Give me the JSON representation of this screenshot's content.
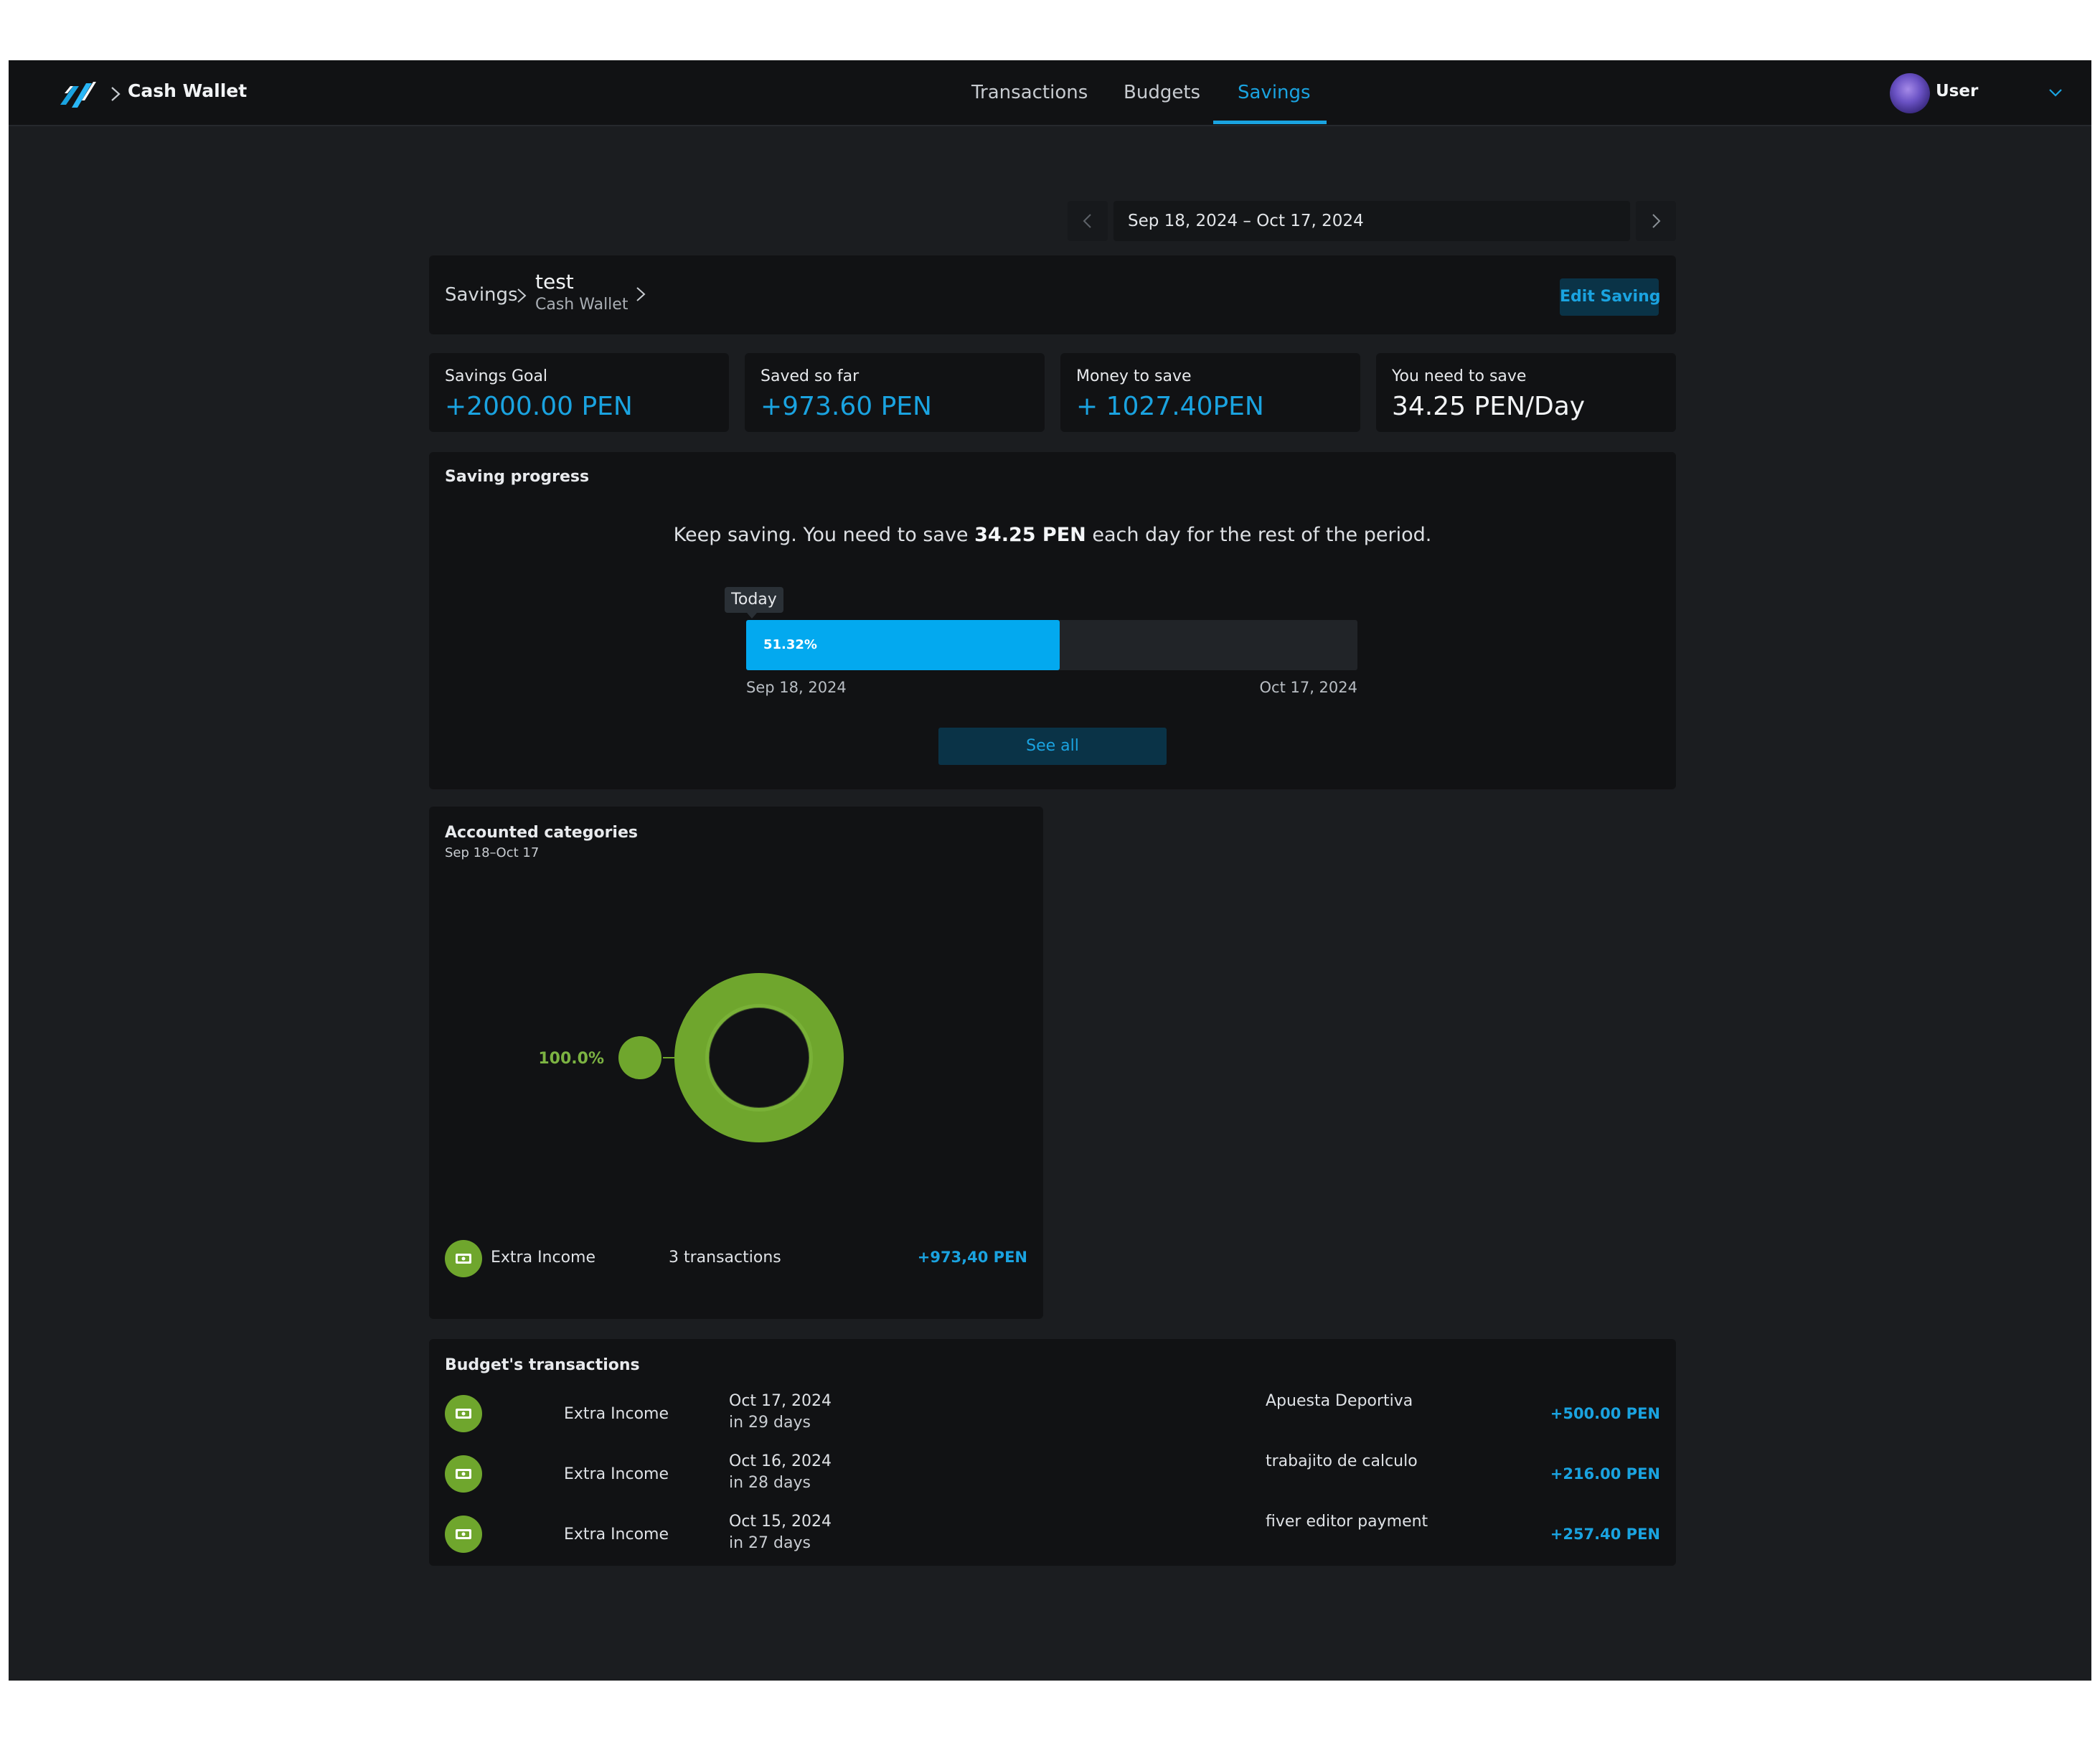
{
  "topbar": {
    "wallet_name": "Cash Wallet",
    "tabs": [
      {
        "label": "Transactions",
        "active": false
      },
      {
        "label": "Budgets",
        "active": false
      },
      {
        "label": "Savings",
        "active": true
      }
    ],
    "user_name": "User",
    "accent_color": "#1aa3e0"
  },
  "period": {
    "range": "Sep 18, 2024 – Oct 17, 2024"
  },
  "breadcrumb": {
    "root": "Savings",
    "saving_name": "test",
    "wallet": "Cash Wallet",
    "edit_label": "Edit Saving"
  },
  "stats": [
    {
      "label": "Savings Goal",
      "value": "+2000.00 PEN"
    },
    {
      "label": "Saved so far",
      "value": "+973.60 PEN"
    },
    {
      "label": "Money to save",
      "value": "+ 1027.40PEN"
    },
    {
      "label": "You need to save",
      "value": "34.25 PEN/Day"
    }
  ],
  "progress": {
    "title": "Saving progress",
    "message_before": "Keep saving. You need to save ",
    "message_amount": "34.25 PEN",
    "message_after": " each day for the rest of the period.",
    "today_label": "Today",
    "percent_label": "51.32%",
    "percent": 51.32,
    "start_date": "Sep 18, 2024",
    "end_date": "Oct 17, 2024",
    "see_all_label": "See all",
    "bar_color": "#03a9ef"
  },
  "categories": {
    "title": "Accounted categories",
    "subtitle": "Sep 18–Oct 17",
    "donut_label": "100.0%",
    "donut_color": "#6fa62d",
    "items": [
      {
        "name": "Extra Income",
        "count": "3 transactions",
        "amount": "+973,40 PEN",
        "icon": "cash-icon"
      }
    ]
  },
  "transactions": {
    "title": "Budget's transactions",
    "rows": [
      {
        "category": "Extra Income",
        "date": "Oct 17, 2024",
        "relative": "in 29 days",
        "description": "Apuesta Deportiva",
        "amount": "+500.00 PEN",
        "icon": "cash-icon"
      },
      {
        "category": "Extra Income",
        "date": "Oct 16, 2024",
        "relative": "in 28 days",
        "description": "trabajito de calculo",
        "amount": "+216.00 PEN",
        "icon": "cash-icon"
      },
      {
        "category": "Extra Income",
        "date": "Oct 15, 2024",
        "relative": "in 27 days",
        "description": "fiver editor payment",
        "amount": "+257.40 PEN",
        "icon": "cash-icon"
      }
    ]
  }
}
